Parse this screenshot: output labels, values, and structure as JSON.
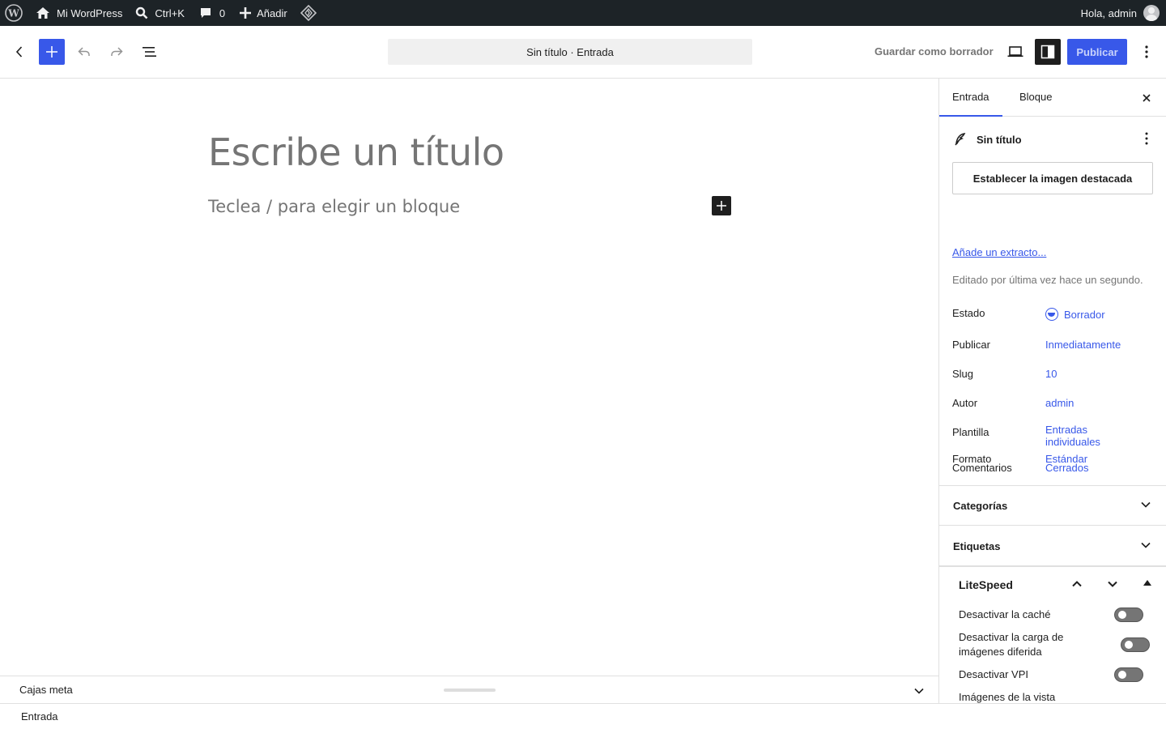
{
  "adminbar": {
    "site_name": "Mi WordPress",
    "search_shortcut": "Ctrl+K",
    "comments_count": "0",
    "add_new": "Añadir",
    "greeting": "Hola, admin"
  },
  "header": {
    "document_title": "Sin título · Entrada",
    "save_draft": "Guardar como borrador",
    "publish": "Publicar",
    "accent_color": "#3858e9"
  },
  "canvas": {
    "title_placeholder": "Escribe un título",
    "block_placeholder": "Teclea / para elegir un bloque"
  },
  "meta_boxes": {
    "label": "Cajas meta"
  },
  "footer": {
    "breadcrumb": "Entrada"
  },
  "sidebar": {
    "tabs": [
      {
        "label": "Entrada",
        "active": true
      },
      {
        "label": "Bloque",
        "active": false
      }
    ],
    "post_title": "Sin título",
    "featured_image_button": "Establecer la imagen destacada",
    "excerpt_link": "Añade un extracto...",
    "last_edited": "Editado por última vez hace un segundo.",
    "fields": [
      {
        "label": "Estado",
        "value": "Borrador"
      },
      {
        "label": "Publicar",
        "value": "Inmediatamente"
      },
      {
        "label": "Slug",
        "value": "10"
      },
      {
        "label": "Autor",
        "value": "admin"
      },
      {
        "label": "Plantilla",
        "value": "Entradas individuales"
      },
      {
        "label": "Comentarios",
        "value": "Cerrados"
      },
      {
        "label": "Formato",
        "value": "Estándar"
      }
    ],
    "panels": [
      {
        "label": "Categorías"
      },
      {
        "label": "Etiquetas"
      }
    ],
    "litespeed": {
      "title": "LiteSpeed",
      "options": [
        {
          "label": "Desactivar la caché",
          "enabled": false
        },
        {
          "label": "Desactivar la carga de imágenes diferida",
          "enabled": false
        },
        {
          "label": "Desactivar VPI",
          "enabled": false
        },
        {
          "label": "Imágenes de la vista"
        }
      ]
    }
  }
}
